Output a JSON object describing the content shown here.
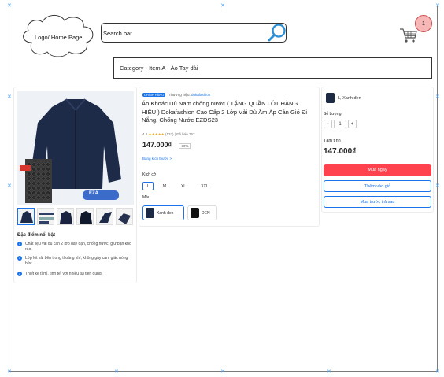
{
  "header": {
    "logo_label": "Logo/ Home Page",
    "search_placeholder": "Search bar",
    "cart_count": "1"
  },
  "breadcrumb": "Category - Item A - Áo Tay dài",
  "gallery": {
    "badge_text": "EZA",
    "thumbnail_count": 6
  },
  "highlights": {
    "title": "Đặc điểm nổi bật",
    "items": [
      "Chất liệu vải dù cản 2 lớp dày dặn, chống nước, giữ bạn khô ráo.",
      "Lớp lót vải bên trong thoáng khí, không gây cảm giác nóng bức.",
      "Thiết kế tỉ mỉ, tinh tế, với nhiều túi tiện dụng."
    ]
  },
  "product": {
    "official_badge": "CHÍNH HÃNG",
    "brand_prefix": "Thương hiệu:",
    "brand_name": "dokafashion",
    "title": "Áo Khoác Dù Nam chống nước ( TẶNG QUẦN LÓT HÀNG HIỆU ) Dokafashion Cao Cấp 2 Lớp Vải Dù Ấm Áp Cản Gió Đi Nắng, Chống Nước EZDS23",
    "rating": "4.8",
    "stars": "★★★★★",
    "review_count": "(133)",
    "sold": "Đã bán 767",
    "price": "147.000₫",
    "discount": "-30%",
    "shipping_link": "Bảng kích thước >",
    "size_label": "Kích cỡ",
    "sizes": [
      "L",
      "M",
      "XL",
      "XXL"
    ],
    "selected_size": "L",
    "color_label": "Màu",
    "colors": [
      "Xanh đen",
      "ĐEN"
    ],
    "selected_color": "Xanh đen"
  },
  "purchase": {
    "variant": "L, Xanh đen",
    "quantity_label": "Số Lượng",
    "quantity": "1",
    "minus": "−",
    "plus": "+",
    "subtotal_label": "Tạm tính",
    "subtotal": "147.000₫",
    "buy_now": "Mua ngay",
    "add_to_cart": "Thêm vào giỏ",
    "buy_later": "Mua trước trả sau"
  },
  "colors": {
    "accent": "#1a73e8",
    "buy_button": "#ff424e",
    "cart_badge": "#f7b7b7"
  }
}
